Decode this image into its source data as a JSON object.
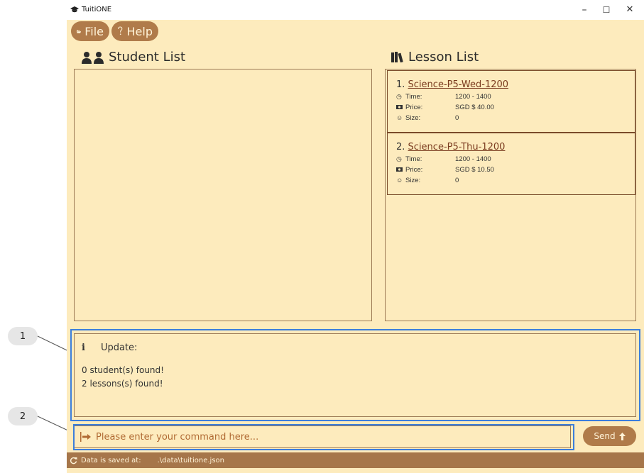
{
  "app": {
    "title": "TuitiONE"
  },
  "window_controls": {
    "minimize": "–",
    "maximize": "☐",
    "close": "✕"
  },
  "menu": {
    "file_label": "File",
    "help_label": "Help"
  },
  "student_panel": {
    "title": "Student List",
    "students": []
  },
  "lesson_panel": {
    "title": "Lesson List",
    "lessons": [
      {
        "index": "1.",
        "name": "Science-P5-Wed-1200",
        "time_label": "Time:",
        "time": "1200 - 1400",
        "price_label": "Price:",
        "price": "SGD $ 40.00",
        "size_label": "Size:",
        "size": "0"
      },
      {
        "index": "2.",
        "name": "Science-P5-Thu-1200",
        "time_label": "Time:",
        "time": "1200 - 1400",
        "price_label": "Price:",
        "price": "SGD $ 10.50",
        "size_label": "Size:",
        "size": "0"
      }
    ]
  },
  "result": {
    "icon": "i",
    "title": "Update:",
    "lines": [
      "0 student(s) found!",
      "2 lessons(s) found!"
    ]
  },
  "command": {
    "placeholder": "Please enter your command here...",
    "value": ""
  },
  "send": {
    "label": "Send"
  },
  "status": {
    "saved_label": "Data is saved at:",
    "path": ".\\data\\tuitione.json"
  },
  "callouts": [
    "1",
    "2"
  ],
  "colors": {
    "background": "#fdebbd",
    "accent": "#b07b4a",
    "statusbar": "#a6764a",
    "highlight": "#3c7edc",
    "border": "#9c7a55"
  }
}
